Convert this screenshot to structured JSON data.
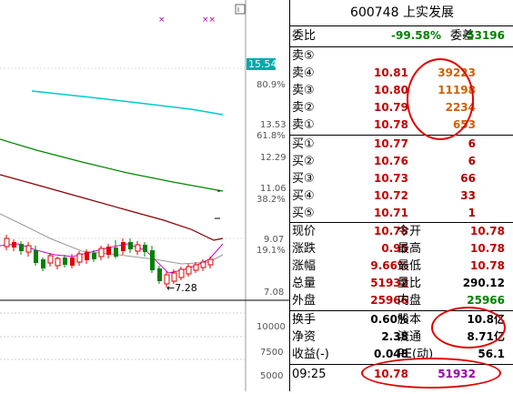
{
  "header": {
    "title": "600748 上实发展"
  },
  "weibi": {
    "label1": "委比",
    "value1": "-99.58%",
    "label2": "委差",
    "value2": "-53196"
  },
  "sell_orders": [
    {
      "label": "卖⑤",
      "price": "",
      "volume": ""
    },
    {
      "label": "卖④",
      "price": "10.81",
      "volume": "39223"
    },
    {
      "label": "卖③",
      "price": "10.80",
      "volume": "11198"
    },
    {
      "label": "卖②",
      "price": "10.79",
      "volume": "2234"
    },
    {
      "label": "卖①",
      "price": "10.78",
      "volume": "653"
    }
  ],
  "buy_orders": [
    {
      "label": "买①",
      "price": "10.77",
      "volume": "6"
    },
    {
      "label": "买②",
      "price": "10.76",
      "volume": "6"
    },
    {
      "label": "买③",
      "price": "10.73",
      "volume": "66"
    },
    {
      "label": "买④",
      "price": "10.72",
      "volume": "33"
    },
    {
      "label": "买⑤",
      "price": "10.71",
      "volume": "1"
    }
  ],
  "quote": [
    {
      "l1": "现价",
      "v1": "10.78",
      "l2": "今开",
      "v2": "10.78"
    },
    {
      "l1": "涨跌",
      "v1": "0.95",
      "l2": "最高",
      "v2": "10.78"
    },
    {
      "l1": "涨幅",
      "v1": "9.66%",
      "l2": "最低",
      "v2": "10.78"
    },
    {
      "l1": "总量",
      "v1": "51932",
      "l2": "量比",
      "v2": "290.12"
    },
    {
      "l1": "外盘",
      "v1": "25966",
      "l2": "内盘",
      "v2": "25966"
    }
  ],
  "fundamentals": [
    {
      "l1": "换手",
      "v1": "0.60%",
      "l2": "股本",
      "v2": "10.8亿"
    },
    {
      "l1": "净资",
      "v1": "2.38",
      "l2": "流通",
      "v2": "8.71亿"
    },
    {
      "l1": "收益(-)",
      "v1": "0.048",
      "l2": "PE(动)",
      "v2": "56.1"
    }
  ],
  "tick": {
    "time": "09:25",
    "price": "10.78",
    "volume": "51932"
  },
  "chart": {
    "price_labels": [
      "15.54",
      "13.53",
      "12.29",
      "11.06",
      "9.07",
      "7.08"
    ],
    "percent_labels": [
      "80.9%",
      "61.8%",
      "38.2%",
      "19.1%"
    ],
    "volume_labels": [
      "10000",
      "7500",
      "5000"
    ],
    "current_price_tag": "15.54",
    "low_annotation": "←7.28",
    "top_markers": "×",
    "top_markers2": "××"
  },
  "colors": {
    "up": "#e00000",
    "down": "#008000",
    "accent_cyan": "#00cccc",
    "tag_bg": "#00aaaa"
  }
}
